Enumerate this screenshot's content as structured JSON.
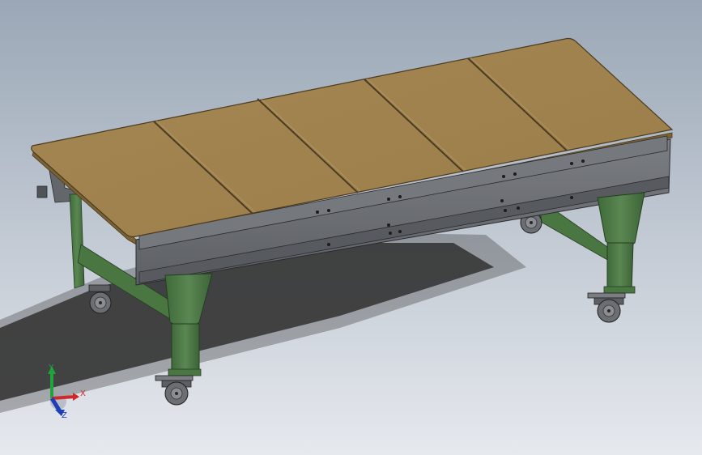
{
  "viewport": {
    "background_top": "#9aa7b6",
    "background_bottom": "#e6e9ee"
  },
  "model": {
    "top_panels": 5,
    "top_color": "#9c7f4a",
    "top_edge_color": "#7b6235",
    "frame_color": "#4f7a47",
    "rail_color": "#6a6d72",
    "caster_color": "#6b6e73"
  },
  "triad": {
    "x_label": "X",
    "y_label": "Y",
    "z_label": "Z",
    "x_color": "#d0282a",
    "y_color": "#21a33b",
    "z_color": "#1e3fb5"
  }
}
